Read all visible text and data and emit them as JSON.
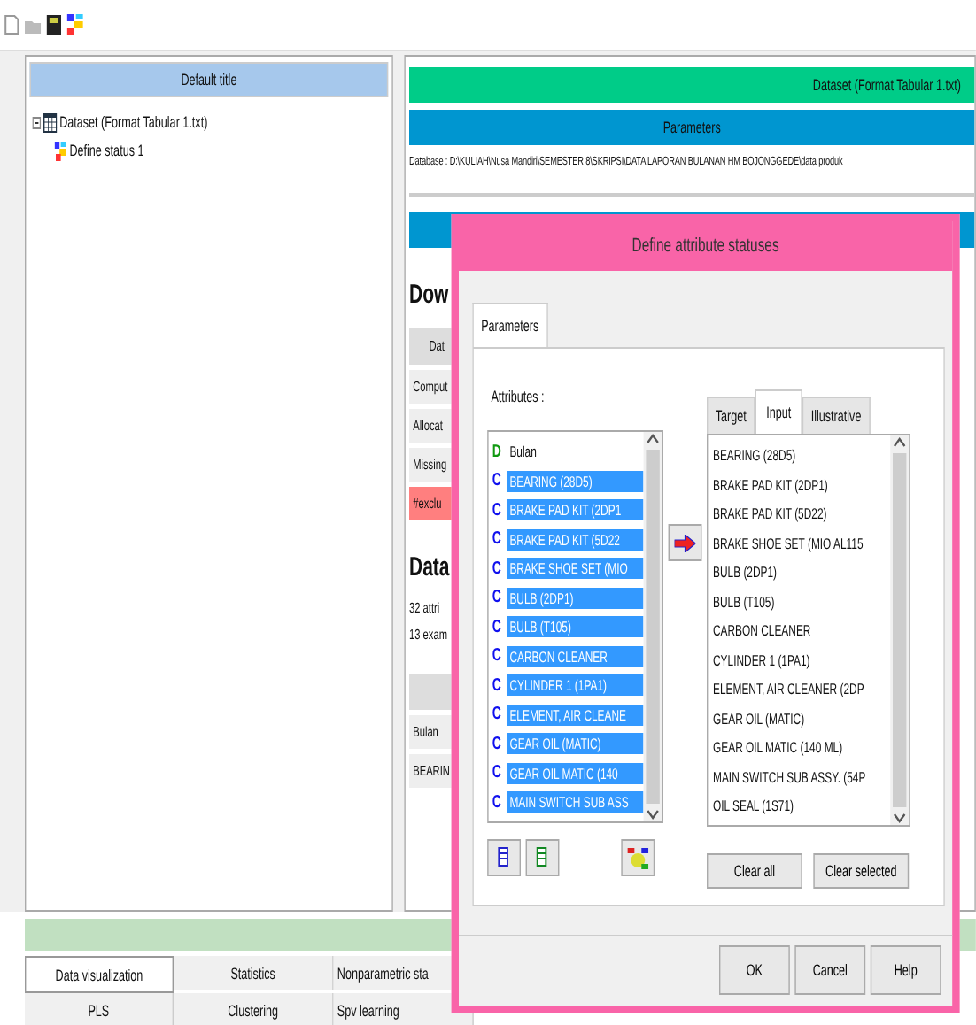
{
  "tree": {
    "title": "Default title",
    "items": [
      {
        "label": "Dataset (Format Tabular 1.txt)",
        "expanded": true,
        "children": [
          {
            "label": "Define status 1"
          }
        ]
      }
    ]
  },
  "report": {
    "dataset_bar": "Dataset (Format Tabular 1.txt)",
    "parameters_bar": "Parameters",
    "database": "Database : D:\\KULIAH\\Nusa Mandiri\\SEMESTER 8\\SKRIPSI\\DATA LAPORAN BULANAN HM BOJONGGEDE\\data produk",
    "heading_1": "Dow",
    "table_1": [
      {
        "label": "Dat",
        "kind": "header"
      },
      {
        "label": "Comput",
        "kind": "row"
      },
      {
        "label": "Allocat",
        "kind": "row"
      },
      {
        "label": "Missing",
        "kind": "row"
      },
      {
        "label": "#exclu",
        "kind": "warning"
      }
    ],
    "heading_2": "Data",
    "lines": [
      "32 attri",
      "13 exam"
    ],
    "table_2": [
      "Bulan",
      "BEARIN"
    ]
  },
  "bottom_tabs": [
    [
      {
        "label": "Data visualization",
        "selected": true
      },
      {
        "label": "Statistics",
        "selected": false
      },
      {
        "label": "Nonparametric sta",
        "selected": false
      }
    ],
    [
      {
        "label": "PLS",
        "selected": false
      },
      {
        "label": "Clustering",
        "selected": false
      },
      {
        "label": "Spv learning",
        "selected": false
      }
    ]
  ],
  "dialog": {
    "title": "Define attribute statuses",
    "tabs": [
      {
        "label": "Parameters",
        "selected": true
      }
    ],
    "attributes_label": "Attributes :",
    "attributes": [
      {
        "type": "D",
        "name": "Bulan",
        "selected": false
      },
      {
        "type": "C",
        "name": "BEARING (28D5)",
        "selected": true
      },
      {
        "type": "C",
        "name": "BRAKE PAD KIT (2DP1",
        "selected": true
      },
      {
        "type": "C",
        "name": "BRAKE PAD KIT (5D22",
        "selected": true
      },
      {
        "type": "C",
        "name": "BRAKE SHOE SET (MIO",
        "selected": true
      },
      {
        "type": "C",
        "name": "BULB (2DP1)",
        "selected": true
      },
      {
        "type": "C",
        "name": "BULB (T105)",
        "selected": true
      },
      {
        "type": "C",
        "name": "CARBON CLEANER",
        "selected": true
      },
      {
        "type": "C",
        "name": "CYLINDER 1 (1PA1)",
        "selected": true
      },
      {
        "type": "C",
        "name": "ELEMENT, AIR CLEANE",
        "selected": true
      },
      {
        "type": "C",
        "name": "GEAR OIL (MATIC)",
        "selected": true
      },
      {
        "type": "C",
        "name": "GEAR OIL MATIC (140",
        "selected": true
      },
      {
        "type": "C",
        "name": "MAIN SWITCH SUB ASS",
        "selected": true
      }
    ],
    "status_tabs": [
      {
        "label": "Target",
        "selected": false
      },
      {
        "label": "Input",
        "selected": true
      },
      {
        "label": "Illustrative",
        "selected": false
      }
    ],
    "input_list": [
      "BEARING (28D5)",
      "BRAKE PAD KIT (2DP1)",
      "BRAKE PAD KIT (5D22)",
      "BRAKE SHOE SET (MIO AL115",
      "BULB (2DP1)",
      "BULB (T105)",
      "CARBON CLEANER",
      "CYLINDER 1 (1PA1)",
      "ELEMENT, AIR CLEANER (2DP",
      "GEAR OIL (MATIC)",
      "GEAR OIL MATIC (140 ML)",
      "MAIN SWITCH SUB ASSY. (54P",
      "OIL SEAL (1S71)"
    ],
    "clear_buttons": [
      "Clear all",
      "Clear selected"
    ],
    "buttons": [
      "OK",
      "Cancel",
      "Help"
    ]
  }
}
